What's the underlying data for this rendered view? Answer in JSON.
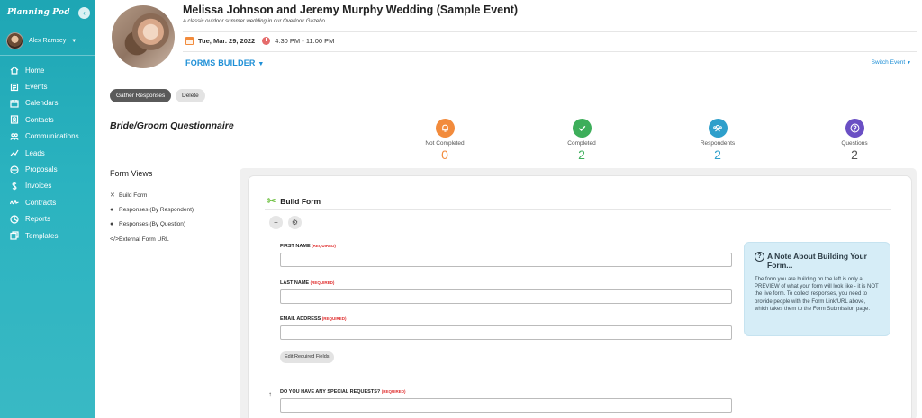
{
  "sidebar": {
    "logo": "Planning Pod",
    "collapse_icon": "‹",
    "user_name": "Alex Ramsey",
    "nav": [
      {
        "label": "Home",
        "icon": "home-icon"
      },
      {
        "label": "Events",
        "icon": "events-icon"
      },
      {
        "label": "Calendars",
        "icon": "calendar-icon"
      },
      {
        "label": "Contacts",
        "icon": "contacts-icon"
      },
      {
        "label": "Communications",
        "icon": "communications-icon"
      },
      {
        "label": "Leads",
        "icon": "leads-icon"
      },
      {
        "label": "Proposals",
        "icon": "proposals-icon"
      },
      {
        "label": "Invoices",
        "icon": "dollar-icon"
      },
      {
        "label": "Contracts",
        "icon": "signature-icon"
      },
      {
        "label": "Reports",
        "icon": "reports-icon"
      },
      {
        "label": "Templates",
        "icon": "templates-icon"
      }
    ]
  },
  "event": {
    "title": "Melissa Johnson and Jeremy Murphy Wedding (Sample Event)",
    "subtitle": "A classic outdoor summer wedding in our Overlook Gazebo",
    "date": "Tue, Mar. 29, 2022",
    "time": "4:30 PM - 11:00 PM"
  },
  "forms_builder_label": "FORMS BUILDER",
  "switch_event_label": "Switch Event",
  "actions": {
    "gather": "Gather Responses",
    "delete": "Delete"
  },
  "form_title": "Bride/Groom Questionnaire",
  "stats": [
    {
      "label": "Not Completed",
      "value": "0",
      "color": "#f28b3c",
      "icon": "bell-icon"
    },
    {
      "label": "Completed",
      "value": "2",
      "color": "#3dae5a",
      "icon": "check-icon"
    },
    {
      "label": "Respondents",
      "value": "2",
      "color": "#2e9fcb",
      "icon": "respondents-icon"
    },
    {
      "label": "Questions",
      "value": "2",
      "color": "#6a4fc4",
      "icon": "question-icon"
    }
  ],
  "form_views": {
    "title": "Form Views",
    "items": [
      {
        "label": "Build Form",
        "icon": "tools-icon"
      },
      {
        "label": "Responses (By Respondent)",
        "icon": "users-icon"
      },
      {
        "label": "Responses (By Question)",
        "icon": "question-circle-icon"
      },
      {
        "label": "External Form URL",
        "icon": "code-icon"
      }
    ]
  },
  "builder": {
    "title": "Build Form",
    "fields": [
      {
        "label": "FIRST NAME",
        "required": "(REQUIRED)"
      },
      {
        "label": "LAST NAME",
        "required": "(REQUIRED)"
      },
      {
        "label": "EMAIL ADDRESS",
        "required": "(REQUIRED)"
      },
      {
        "label": "DO YOU HAVE ANY SPECIAL REQUESTS?",
        "required": "(REQUIRED)"
      }
    ],
    "edit_required_label": "Edit Required Fields"
  },
  "note": {
    "title": "A Note About Building Your Form...",
    "body": "The form you are building on the left is only a PREVIEW of what your form will look like - it is NOT the live form. To collect responses, you need to provide people with the Form Link/URL above, which takes them to the Form Submission page."
  }
}
